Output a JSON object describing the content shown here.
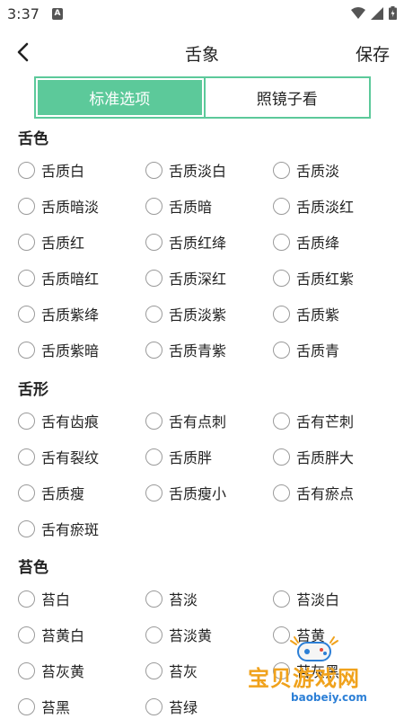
{
  "status": {
    "time": "3:37",
    "notification_icon": "A"
  },
  "header": {
    "title": "舌象",
    "save_label": "保存",
    "back_icon": "back-arrow-icon"
  },
  "tabs": [
    {
      "label": "标准选项",
      "active": true
    },
    {
      "label": "照镜子看",
      "active": false
    }
  ],
  "sections": [
    {
      "title": "舌色",
      "options": [
        "舌质白",
        "舌质淡白",
        "舌质淡",
        "舌质暗淡",
        "舌质暗",
        "舌质淡红",
        "舌质红",
        "舌质红绛",
        "舌质绛",
        "舌质暗红",
        "舌质深红",
        "舌质红紫",
        "舌质紫绛",
        "舌质淡紫",
        "舌质紫",
        "舌质紫暗",
        "舌质青紫",
        "舌质青"
      ]
    },
    {
      "title": "舌形",
      "options": [
        "舌有齿痕",
        "舌有点刺",
        "舌有芒刺",
        "舌有裂纹",
        "舌质胖",
        "舌质胖大",
        "舌质瘦",
        "舌质瘦小",
        "舌有瘀点",
        "舌有瘀斑"
      ]
    },
    {
      "title": "苔色",
      "options": [
        "苔白",
        "苔淡",
        "苔淡白",
        "苔黄白",
        "苔淡黄",
        "苔黄",
        "苔灰黄",
        "苔灰",
        "苔灰黑",
        "苔黑",
        "苔绿"
      ]
    }
  ],
  "watermark": {
    "title": "宝贝游戏网",
    "url": "baobeiy.com"
  },
  "colors": {
    "accent": "#5cc99a",
    "radio_border": "#9a9a9a",
    "watermark_orange": "#f0a21c",
    "watermark_blue": "#2c7fd6"
  }
}
